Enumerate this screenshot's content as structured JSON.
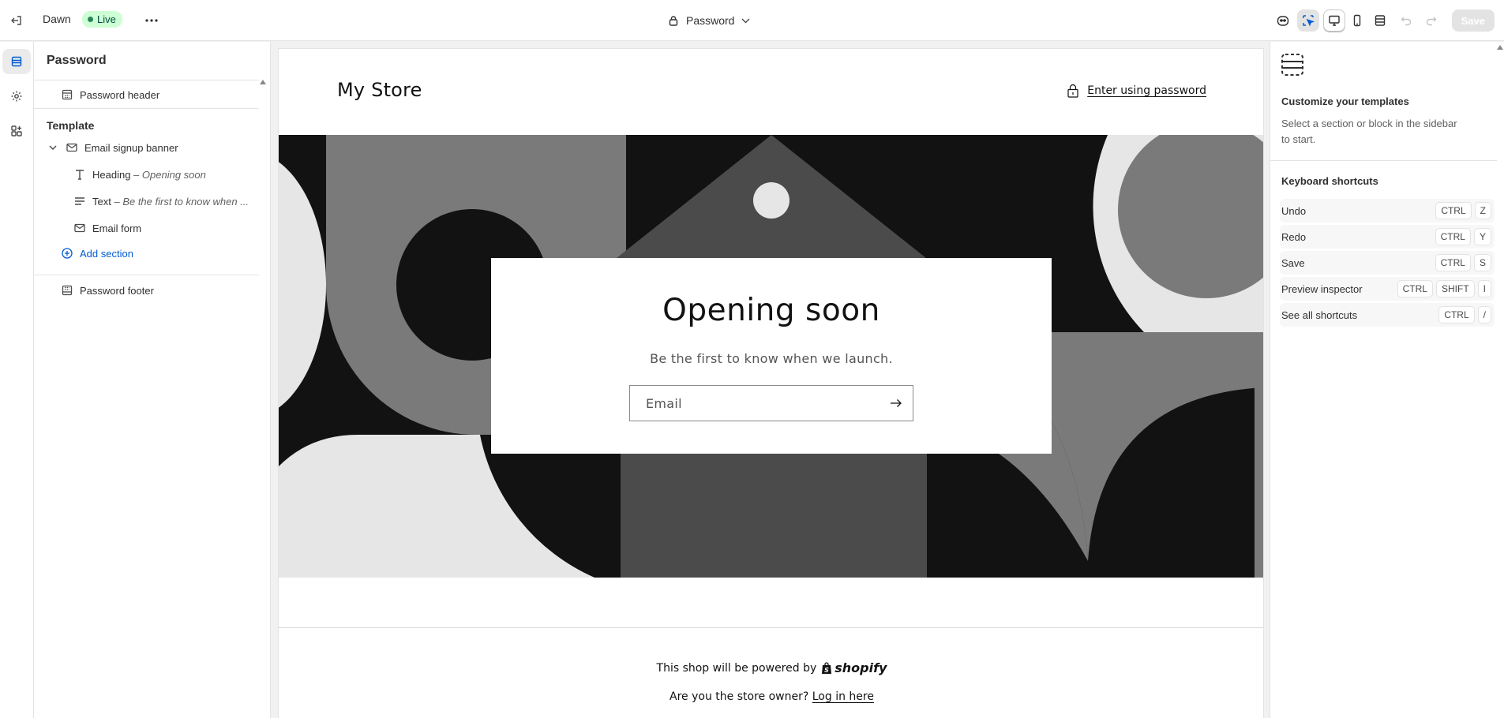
{
  "topbar": {
    "theme_name": "Dawn",
    "live_badge": "Live",
    "page_selector": "Password",
    "save_label": "Save"
  },
  "sidebar": {
    "title": "Password",
    "header_section": "Password header",
    "template_group": "Template",
    "section": "Email signup banner",
    "blocks": [
      {
        "label": "Heading",
        "detail": "Opening soon"
      },
      {
        "label": "Text",
        "detail": "Be the first to know when ..."
      },
      {
        "label": "Email form",
        "detail": ""
      }
    ],
    "add_section": "Add section",
    "footer_section": "Password footer",
    "detail_separator": " – "
  },
  "preview": {
    "store_name": "My Store",
    "enter_password": "Enter using password",
    "heading": "Opening soon",
    "subtext": "Be the first to know when we launch.",
    "email_placeholder": "Email",
    "powered_by": "This shop will be powered by",
    "shopify_brand": "shopify",
    "owner_prompt": "Are you the store owner?",
    "login_link": "Log in here"
  },
  "right_panel": {
    "title": "Customize your templates",
    "description": "Select a section or block in the sidebar to start.",
    "shortcuts_title": "Keyboard shortcuts",
    "shortcuts": [
      {
        "label": "Undo",
        "keys": [
          "CTRL",
          "Z"
        ]
      },
      {
        "label": "Redo",
        "keys": [
          "CTRL",
          "Y"
        ]
      },
      {
        "label": "Save",
        "keys": [
          "CTRL",
          "S"
        ]
      },
      {
        "label": "Preview inspector",
        "keys": [
          "CTRL",
          "SHIFT",
          "I"
        ]
      },
      {
        "label": "See all shortcuts",
        "keys": [
          "CTRL",
          "/"
        ]
      }
    ]
  },
  "colors": {
    "live_bg": "#cdfed4",
    "live_dot": "#29845a",
    "link_blue": "#005bd3",
    "banner_dark": "#121212",
    "banner_mid": "#7a7a7a",
    "banner_light": "#e6e6e6"
  }
}
